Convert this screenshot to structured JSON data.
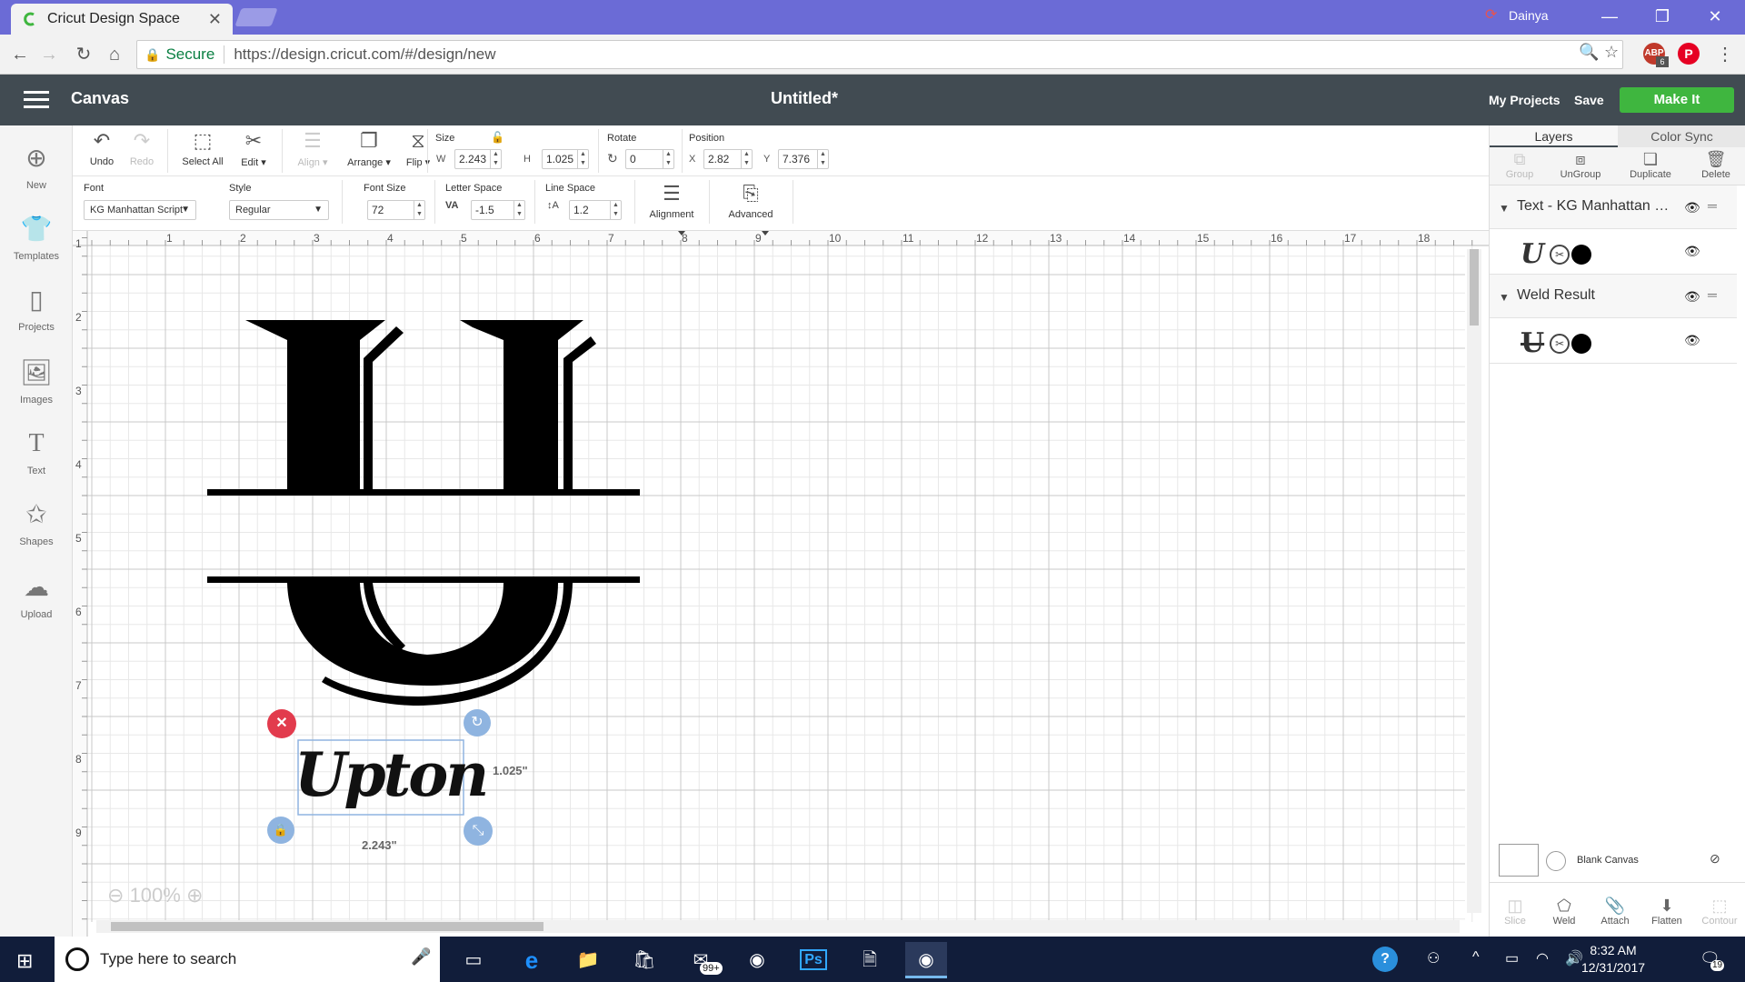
{
  "browser": {
    "tab_title": "Cricut Design Space",
    "user": "Dainya",
    "secure_label": "Secure",
    "url": "https://design.cricut.com/#/design/new",
    "extension_badge": "6",
    "extension_abp": "ABP"
  },
  "header": {
    "app_title": "Canvas",
    "doc_title": "Untitled*",
    "my_projects": "My Projects",
    "save": "Save",
    "make_it": "Make It"
  },
  "sidebar": {
    "items": [
      {
        "label": "New",
        "icon": "plus-circle-icon"
      },
      {
        "label": "Templates",
        "icon": "shirt-icon"
      },
      {
        "label": "Projects",
        "icon": "bookmark-icon"
      },
      {
        "label": "Images",
        "icon": "image-icon"
      },
      {
        "label": "Text",
        "icon": "text-icon"
      },
      {
        "label": "Shapes",
        "icon": "shapes-icon"
      },
      {
        "label": "Upload",
        "icon": "cloud-upload-icon"
      }
    ]
  },
  "toolbar": {
    "undo": "Undo",
    "redo": "Redo",
    "select_all": "Select All",
    "edit": "Edit",
    "align": "Align",
    "arrange": "Arrange",
    "flip": "Flip",
    "size_label": "Size",
    "w_label": "W",
    "w_value": "2.243",
    "h_label": "H",
    "h_value": "1.025",
    "rotate_label": "Rotate",
    "rotate_value": "0",
    "position_label": "Position",
    "x_label": "X",
    "x_value": "2.82",
    "y_label": "Y",
    "y_value": "7.376"
  },
  "text_toolbar": {
    "font_label": "Font",
    "font_value": "KG Manhattan Script",
    "style_label": "Style",
    "style_value": "Regular",
    "font_size_label": "Font Size",
    "font_size_value": "72",
    "letter_space_label": "Letter Space",
    "letter_space_value": "-1.5",
    "line_space_label": "Line Space",
    "line_space_value": "1.2",
    "alignment": "Alignment",
    "advanced": "Advanced"
  },
  "canvas": {
    "ruler_top": [
      "1",
      "2",
      "3",
      "4",
      "5",
      "6",
      "7",
      "8",
      "9",
      "10",
      "11",
      "12",
      "13",
      "14",
      "15",
      "16",
      "17",
      "18"
    ],
    "ruler_left": [
      "1",
      "2",
      "3",
      "4",
      "5",
      "6",
      "7",
      "8",
      "9"
    ],
    "zoom": "100%",
    "text_object": "Upton",
    "height_dim": "1.025\"",
    "width_dim": "2.243\""
  },
  "right_panel": {
    "tabs": [
      "Layers",
      "Color Sync"
    ],
    "actions": [
      "Group",
      "UnGroup",
      "Duplicate",
      "Delete"
    ],
    "layers": [
      {
        "name": "Text - KG Manhattan Script",
        "thumb": "U"
      },
      {
        "name": "Weld Result",
        "thumb": "U"
      }
    ],
    "blank_canvas": "Blank Canvas",
    "bottom_actions": [
      "Slice",
      "Weld",
      "Attach",
      "Flatten",
      "Contour"
    ]
  },
  "taskbar": {
    "search_placeholder": "Type here to search",
    "mail_badge": "99+",
    "ps_label": "Ps",
    "time": "8:32 AM",
    "date": "12/31/2017",
    "notif_count": "19"
  },
  "colors": {
    "titlebar": "#6b6bd6",
    "header": "#414b52",
    "make_it": "#3fb63f",
    "taskbar": "#111d3a",
    "delete_handle": "#e23b4d",
    "handle_blue": "#8fb4e0"
  }
}
